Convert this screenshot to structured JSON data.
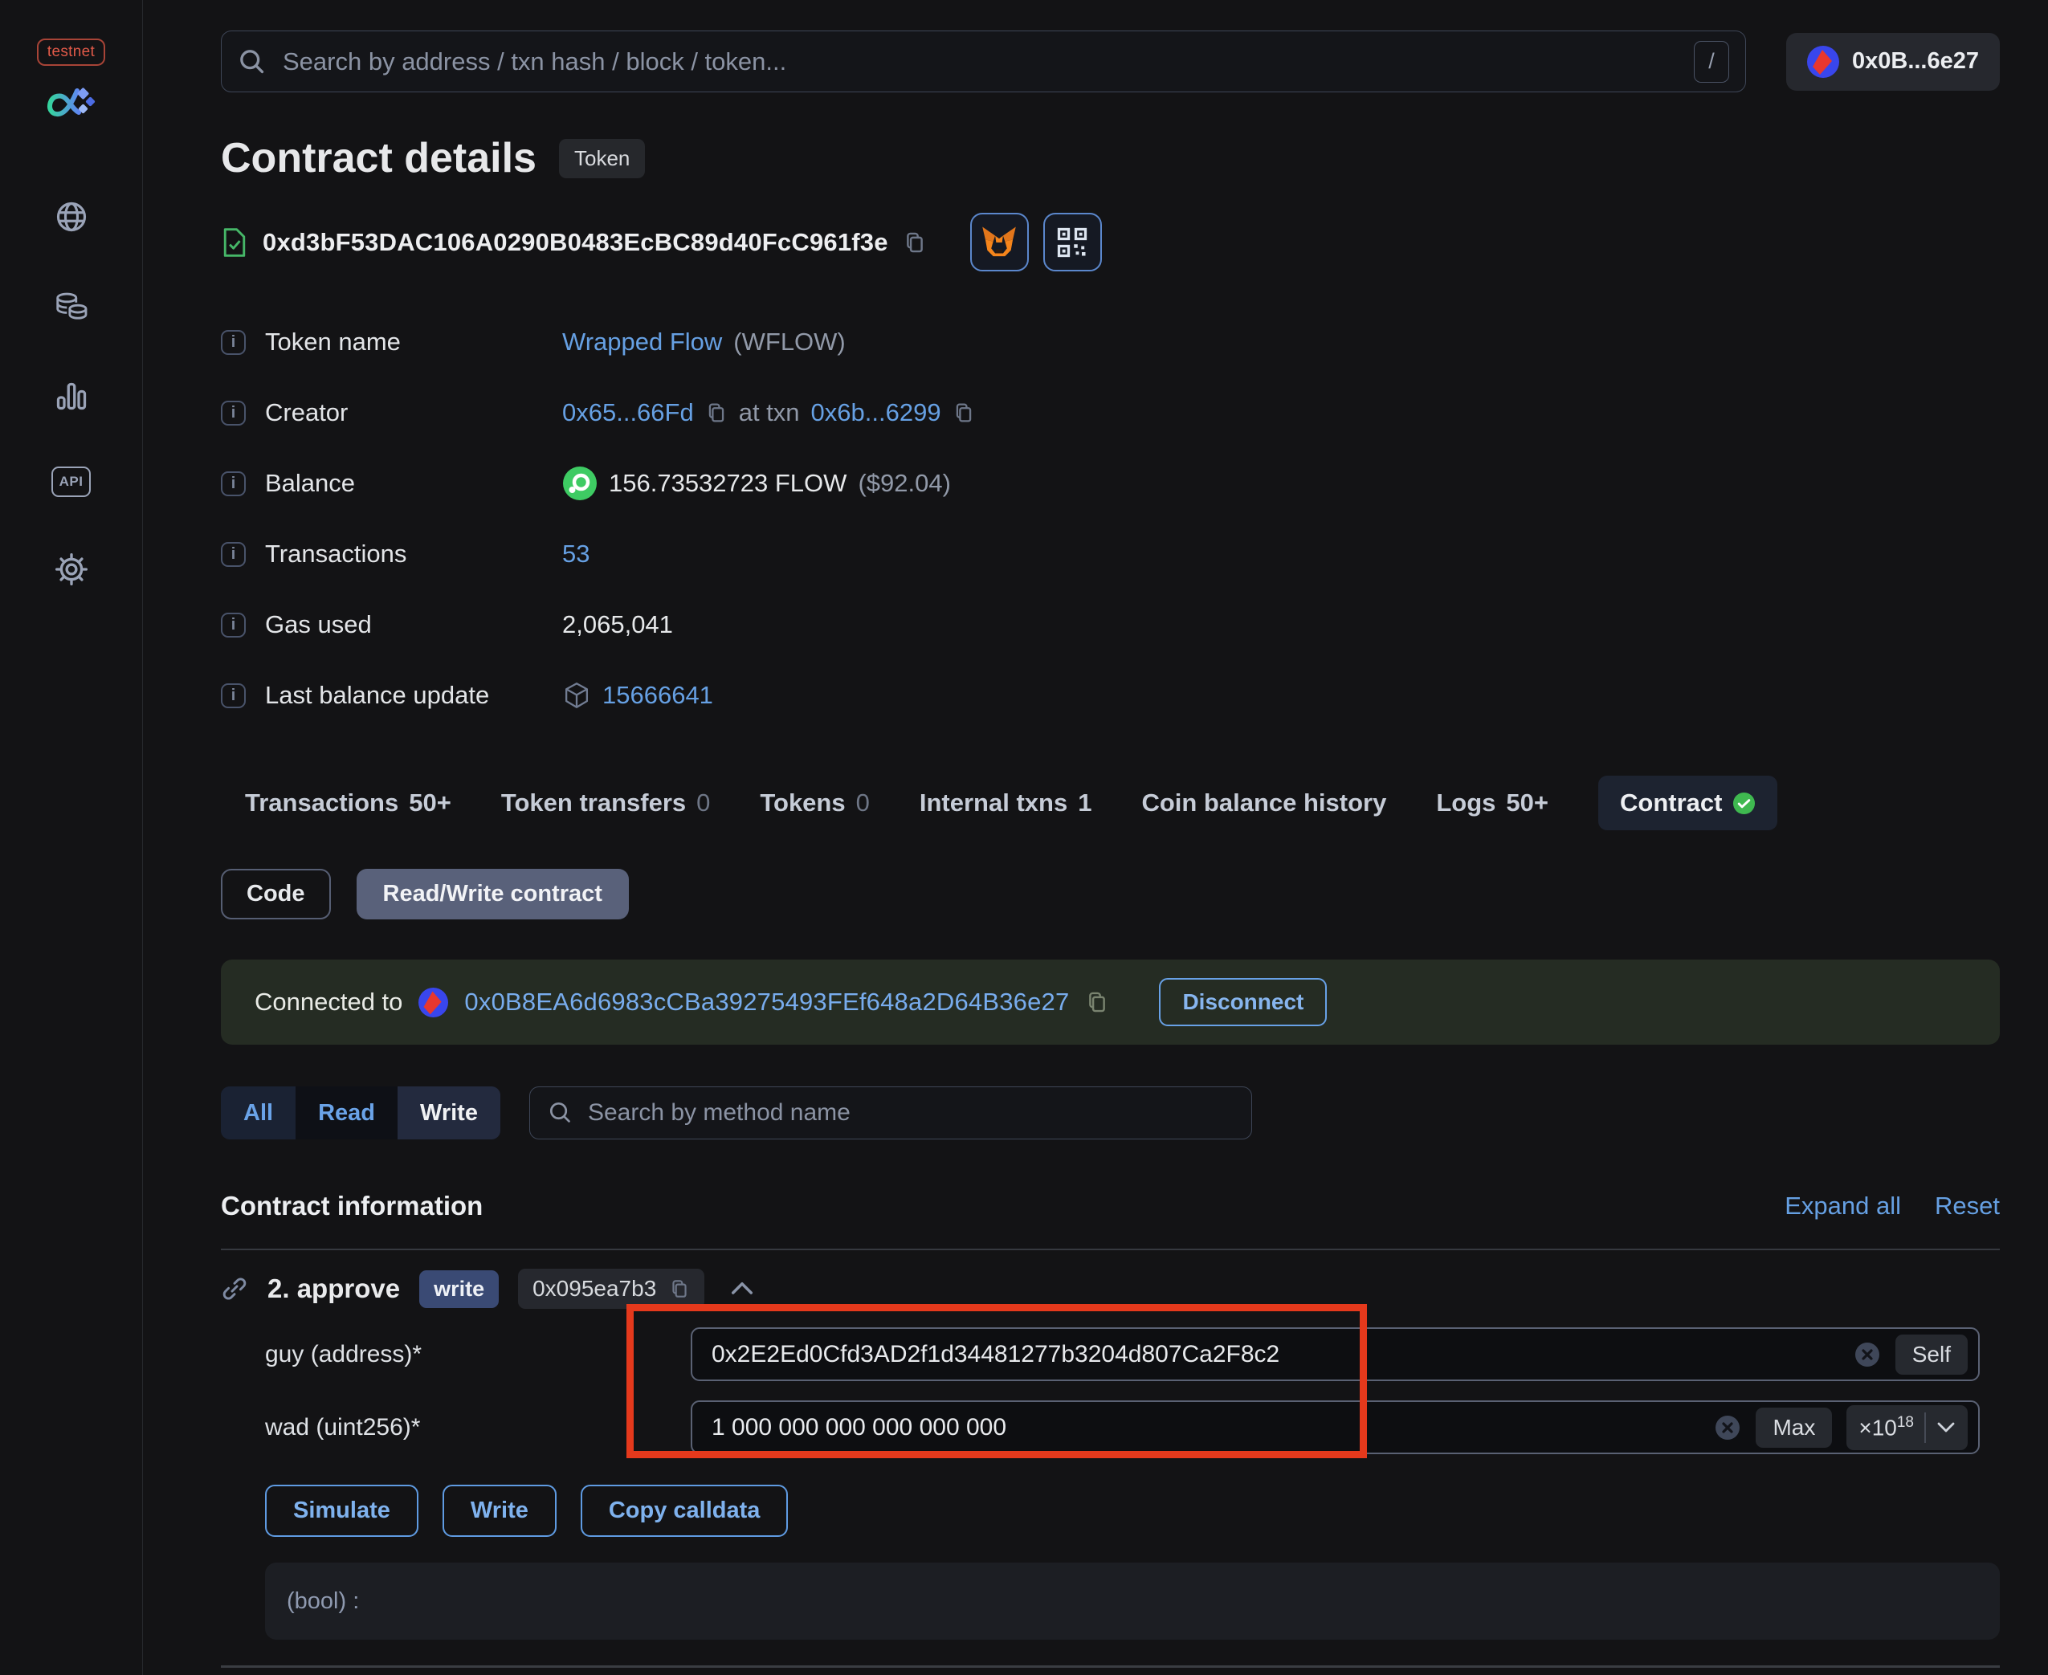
{
  "sidebar": {
    "network_badge": "testnet",
    "nav_icons": [
      "globe",
      "tokens",
      "charts",
      "api",
      "settings"
    ]
  },
  "topbar": {
    "search_placeholder": "Search by address / txn hash / block / token...",
    "search_shortcut": "/",
    "account_address": "0x0B...6e27"
  },
  "header": {
    "title": "Contract details",
    "type_badge": "Token",
    "address": "0xd3bF53DAC106A0290B0483EcBC89d40FcC961f3e"
  },
  "info": {
    "token_name": {
      "label": "Token name",
      "link": "Wrapped Flow",
      "symbol": "(WFLOW)"
    },
    "creator": {
      "label": "Creator",
      "address": "0x65...66Fd",
      "at_txn": "at txn",
      "txn": "0x6b...6299"
    },
    "balance": {
      "label": "Balance",
      "amount": "156.73532723 FLOW",
      "usd": "($92.04)"
    },
    "transactions": {
      "label": "Transactions",
      "value": "53"
    },
    "gas_used": {
      "label": "Gas used",
      "value": "2,065,041"
    },
    "last_balance_update": {
      "label": "Last balance update",
      "value": "15666641"
    }
  },
  "tabs": {
    "items": [
      {
        "label": "Transactions",
        "count": "50+"
      },
      {
        "label": "Token transfers",
        "count": "0"
      },
      {
        "label": "Tokens",
        "count": "0"
      },
      {
        "label": "Internal txns",
        "count": "1"
      },
      {
        "label": "Coin balance history",
        "count": ""
      },
      {
        "label": "Logs",
        "count": "50+"
      },
      {
        "label": "Contract",
        "count": ""
      }
    ]
  },
  "subtabs": {
    "code": "Code",
    "read_write": "Read/Write contract"
  },
  "connected": {
    "label": "Connected to",
    "address": "0x0B8EA6d6983cCBa39275493FEf648a2D64B36e27",
    "disconnect": "Disconnect"
  },
  "methods_filter": {
    "all": "All",
    "read": "Read",
    "write": "Write",
    "search_placeholder": "Search by method name"
  },
  "contract_info": {
    "title": "Contract information",
    "expand_all": "Expand all",
    "reset": "Reset"
  },
  "method": {
    "name": "2. approve",
    "type_badge": "write",
    "selector": "0x095ea7b3",
    "fields": [
      {
        "label": "guy (address)*",
        "value": "0x2E2Ed0Cfd3AD2f1d34481277b3204d807Ca2F8c2",
        "action": "Self"
      },
      {
        "label": "wad (uint256)*",
        "value": "1 000 000 000 000 000 000",
        "action": "Max",
        "multiplier": "×10",
        "exponent": "18"
      }
    ],
    "buttons": {
      "simulate": "Simulate",
      "write": "Write",
      "copy_calldata": "Copy calldata"
    },
    "output": "(bool) :"
  },
  "colors": {
    "accent_link": "#66a0e3",
    "annotation_red": "#e5391c",
    "verified_green": "#3fb950",
    "flow_green": "#3ecb63",
    "connected_bg": "#252c23",
    "write_badge_bg": "#3a4a74"
  }
}
